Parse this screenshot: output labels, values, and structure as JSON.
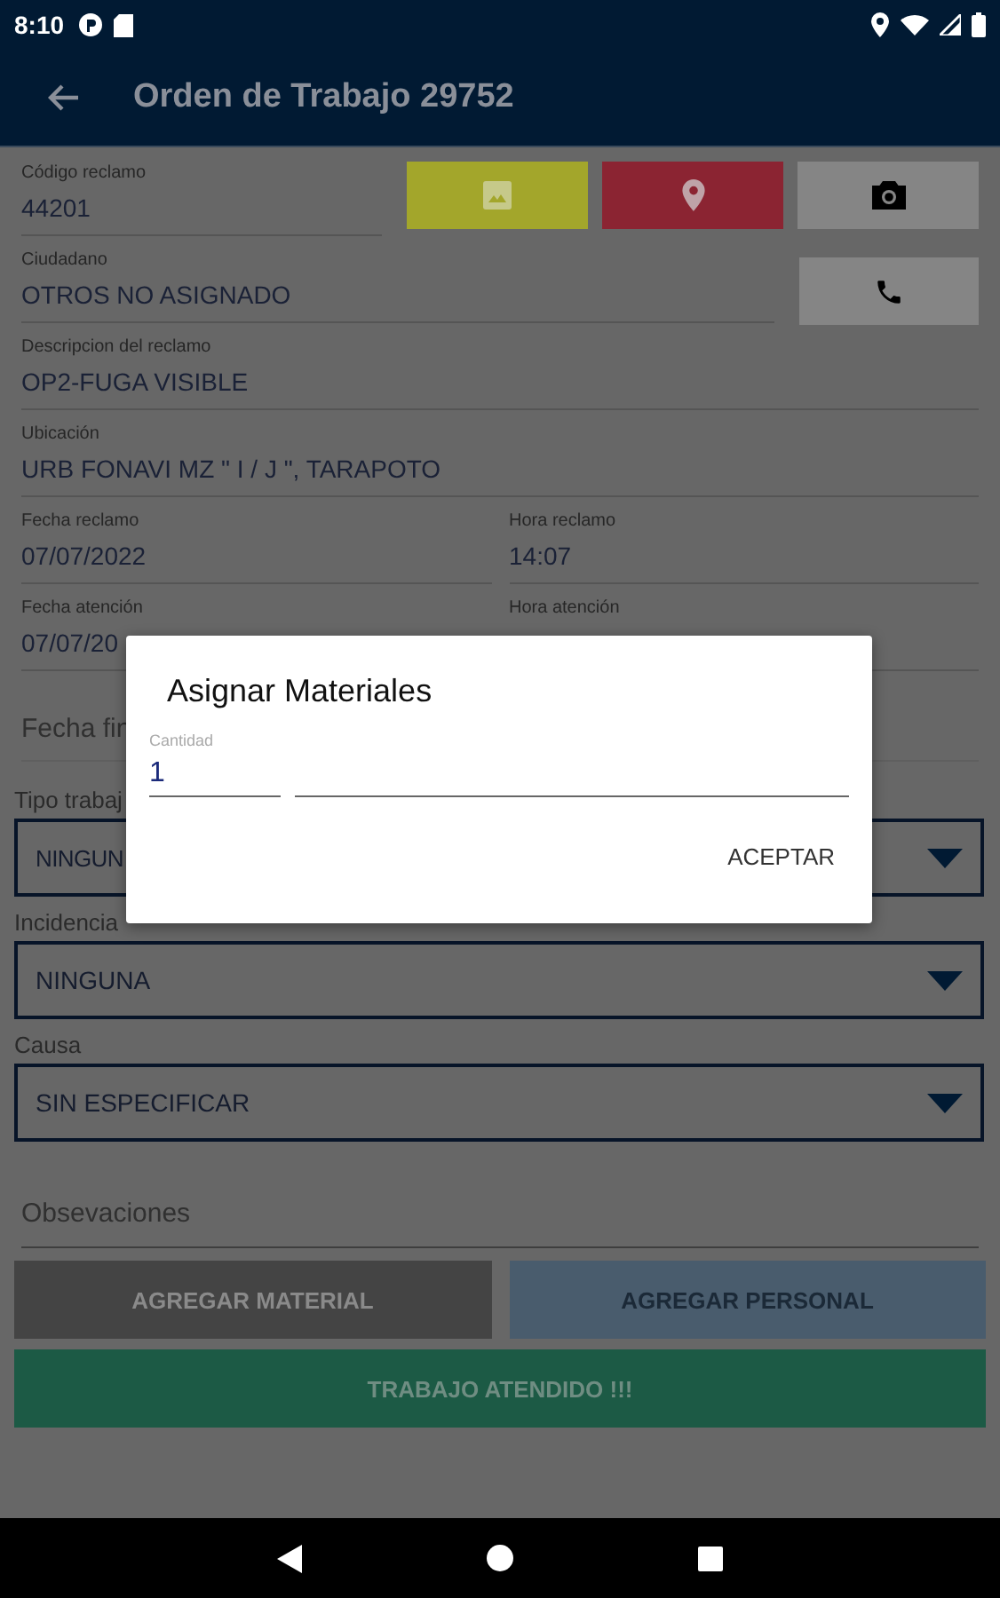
{
  "status_bar": {
    "time": "8:10"
  },
  "app_bar": {
    "title": "Orden de Trabajo 29752"
  },
  "codigo_reclamo": {
    "label": "Código reclamo",
    "value": "44201"
  },
  "ciudadano": {
    "label": "Ciudadano",
    "value": "OTROS NO ASIGNADO"
  },
  "descripcion": {
    "label": "Descripcion del reclamo",
    "value": "OP2-FUGA VISIBLE"
  },
  "ubicacion": {
    "label": "Ubicación",
    "value": "URB FONAVI MZ \" I / J \", TARAPOTO"
  },
  "fecha_reclamo": {
    "label": "Fecha reclamo",
    "value": "07/07/2022"
  },
  "hora_reclamo": {
    "label": "Hora reclamo",
    "value": "14:07"
  },
  "fecha_atencion": {
    "label": "Fecha atención",
    "value": "07/07/20"
  },
  "hora_atencion": {
    "label": "Hora atención"
  },
  "fecha_fin": {
    "placeholder": "Fecha fin"
  },
  "tipo_trabajo": {
    "label": "Tipo trabaj",
    "value": "NINGUN"
  },
  "incidencia": {
    "label": "Incidencia",
    "value": "NINGUNA"
  },
  "causa": {
    "label": "Causa",
    "value": "SIN ESPECIFICAR"
  },
  "observaciones": {
    "placeholder": "Obsevaciones"
  },
  "buttons": [
    {
      "label": "AGREGAR MATERIAL",
      "kind": "material"
    },
    {
      "label": "AGREGAR PERSONAL",
      "kind": "personal"
    }
  ],
  "submit_button": {
    "label": "TRABAJO ATENDIDO !!!"
  },
  "dialog": {
    "title": "Asignar Materiales",
    "field_label": "Cantidad",
    "value": "1",
    "button": "ACEPTAR"
  }
}
